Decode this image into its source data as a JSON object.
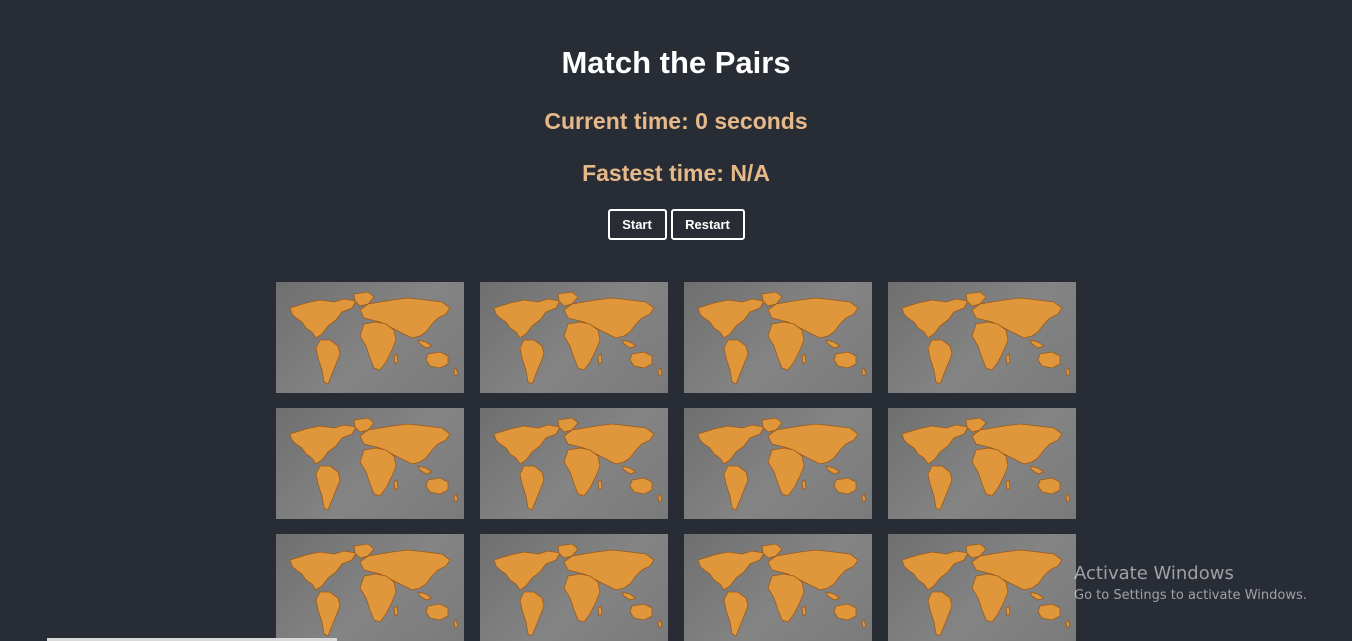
{
  "title": "Match the Pairs",
  "current_time": "Current time: 0 seconds",
  "fastest_time": "Fastest time: N/A",
  "buttons": {
    "start": "Start",
    "restart": "Restart"
  },
  "cards": [
    {
      "face": "world-map-card-back"
    },
    {
      "face": "world-map-card-back"
    },
    {
      "face": "world-map-card-back"
    },
    {
      "face": "world-map-card-back"
    },
    {
      "face": "world-map-card-back"
    },
    {
      "face": "world-map-card-back"
    },
    {
      "face": "world-map-card-back"
    },
    {
      "face": "world-map-card-back"
    },
    {
      "face": "world-map-card-back"
    },
    {
      "face": "world-map-card-back"
    },
    {
      "face": "world-map-card-back"
    },
    {
      "face": "world-map-card-back"
    }
  ],
  "os_watermark": {
    "title": "Activate Windows",
    "subtitle": "Go to Settings to activate Windows."
  },
  "colors": {
    "background": "#282c35",
    "accent_text": "#e6b98a",
    "map_fill": "#e0963a"
  }
}
